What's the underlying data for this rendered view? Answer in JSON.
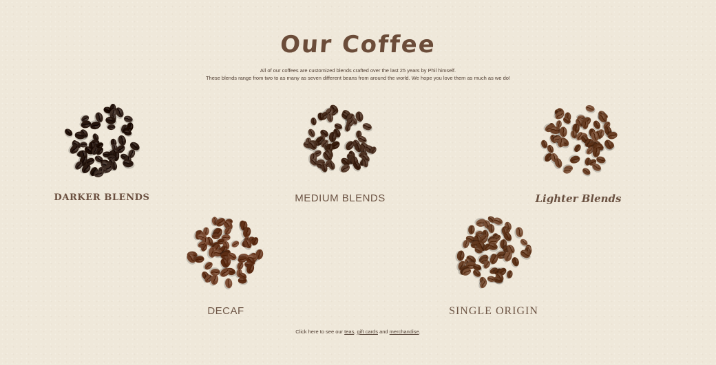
{
  "title": "Our Coffee",
  "intro": {
    "line1": "All of our coffees are customized blends crafted over the last 25 years by Phil himself.",
    "line2": "These blends range from two to as many as seven different beans from around the world. We hope you love them as much as we do!"
  },
  "categories": [
    {
      "id": "darker",
      "label": "DARKER BLENDS",
      "bean_color": "#2e1d14"
    },
    {
      "id": "medium",
      "label": "MEDIUM BLENDS",
      "bean_color": "#4a2f1f"
    },
    {
      "id": "lighter",
      "label": "Lighter Blends",
      "bean_color": "#6b4127"
    },
    {
      "id": "decaf",
      "label": "DECAF",
      "bean_color": "#6e3f26"
    },
    {
      "id": "single",
      "label": "SINGLE ORIGIN",
      "bean_color": "#6b4228"
    }
  ],
  "footer": {
    "prefix": "Click here to see our",
    "link_teas": "teas",
    "sep1": ",",
    "link_gift": "gift cards",
    "and": "and",
    "link_merch": "merchandise",
    "suffix": "."
  }
}
